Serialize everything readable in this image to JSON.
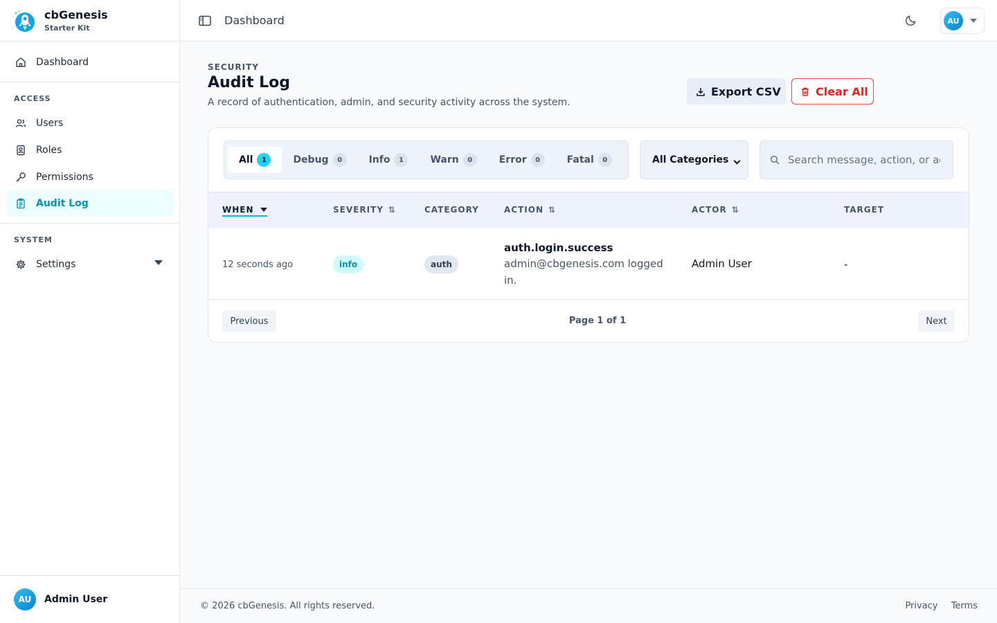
{
  "brand": {
    "name": "cbGenesis",
    "subtitle": "Starter Kit"
  },
  "sidebar": {
    "dashboard": "Dashboard",
    "access_heading": "ACCESS",
    "access_items": [
      "Users",
      "Roles",
      "Permissions",
      "Audit Log"
    ],
    "system_heading": "SYSTEM",
    "settings": "Settings",
    "footer_user": "Admin User",
    "footer_initials": "AU"
  },
  "header": {
    "title": "Dashboard",
    "initials": "AU"
  },
  "page": {
    "eyebrow": "SECURITY",
    "title": "Audit Log",
    "description": "A record of authentication, admin, and security activity across the system.",
    "export_label": "Export CSV",
    "clear_label": "Clear All"
  },
  "filters": {
    "tabs": [
      {
        "label": "All",
        "count": "1"
      },
      {
        "label": "Debug",
        "count": "0"
      },
      {
        "label": "Info",
        "count": "1"
      },
      {
        "label": "Warn",
        "count": "0"
      },
      {
        "label": "Error",
        "count": "0"
      },
      {
        "label": "Fatal",
        "count": "0"
      }
    ],
    "category": "All Categories",
    "search_placeholder": "Search message, action, or actor"
  },
  "table": {
    "columns": [
      "WHEN",
      "SEVERITY",
      "CATEGORY",
      "ACTION",
      "ACTOR",
      "TARGET"
    ],
    "sort_glyph": "⇅",
    "rows": [
      {
        "when": "12 seconds ago",
        "severity": "info",
        "category": "auth",
        "action": "auth.login.success",
        "message": "admin@cbgenesis.com logged in.",
        "actor": "Admin User",
        "target": "-"
      }
    ]
  },
  "pagination": {
    "previous": "Previous",
    "info": "Page 1 of 1",
    "next": "Next"
  },
  "footer": {
    "copyright": "© 2026 cbGenesis. All rights reserved.",
    "privacy": "Privacy",
    "terms": "Terms",
    "separator": "·"
  },
  "colors": {
    "accent": "#06b6d4",
    "accent_bg": "#ecfeff",
    "danger": "#dc2626"
  }
}
